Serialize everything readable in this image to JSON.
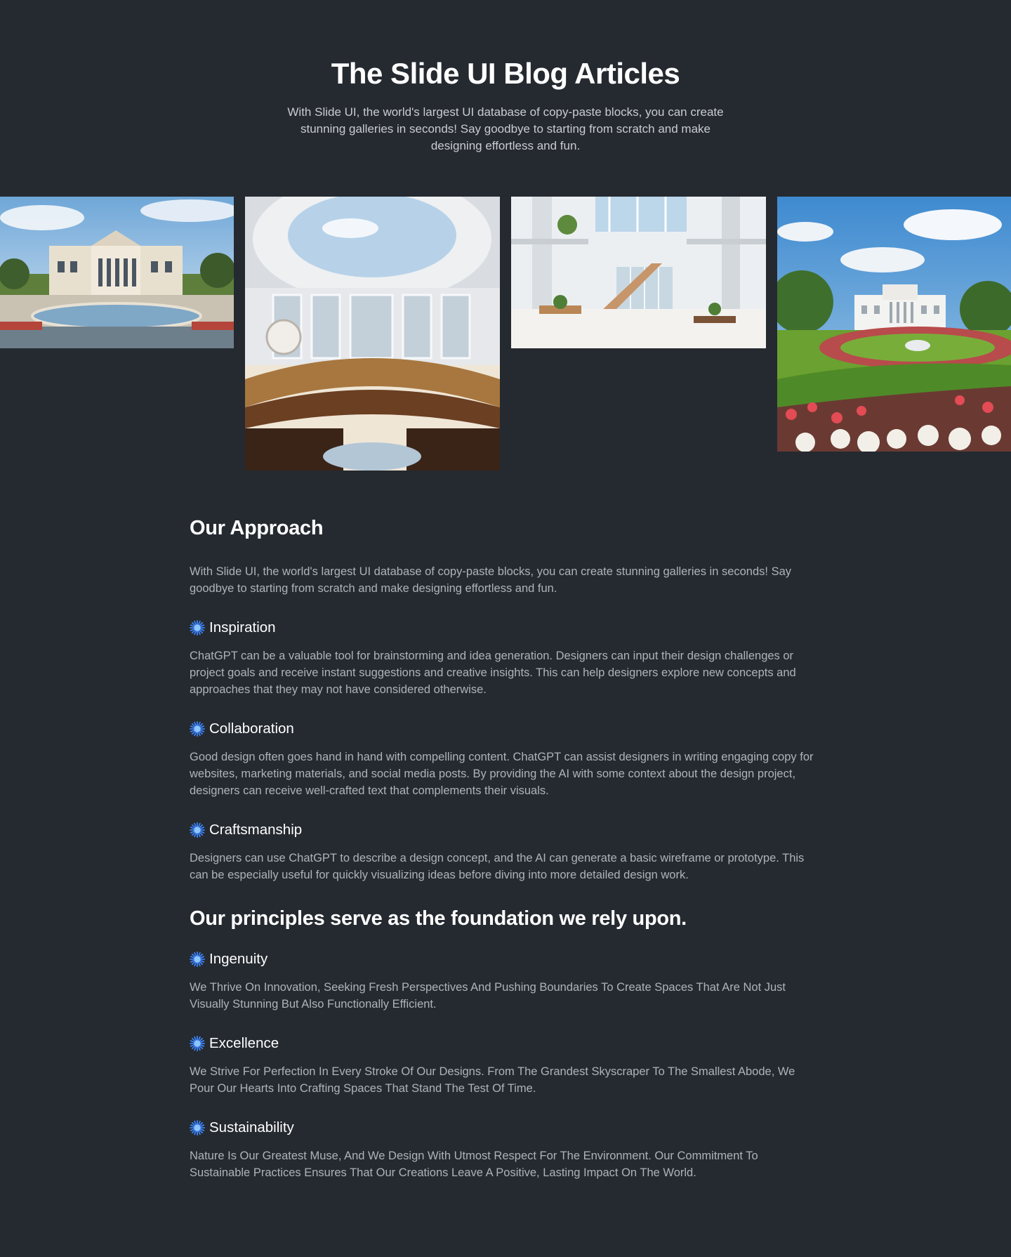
{
  "header": {
    "title": "The Slide UI Blog Articles",
    "subtitle": "With Slide UI, the world's largest UI database of copy-paste blocks, you can create stunning galleries in seconds! Say goodbye to starting from scratch and make designing effortless and fun."
  },
  "gallery": {
    "images": [
      {
        "alt": "Neoclassical mansion with fountain pool"
      },
      {
        "alt": "Domed council chamber interior"
      },
      {
        "alt": "Bright atrium interior with staircase"
      },
      {
        "alt": "White House with flower garden lawn"
      }
    ]
  },
  "approach": {
    "heading": "Our Approach",
    "intro": "With Slide UI, the world's largest UI database of copy-paste blocks, you can create stunning galleries in seconds! Say goodbye to starting from scratch and make designing effortless and fun.",
    "items": [
      {
        "title": "Inspiration",
        "text": "ChatGPT can be a valuable tool for brainstorming and idea generation. Designers can input their design challenges or project goals and receive instant suggestions and creative insights. This can help designers explore new concepts and approaches that they may not have considered otherwise."
      },
      {
        "title": "Collaboration",
        "text": "Good design often goes hand in hand with compelling content. ChatGPT can assist designers in writing engaging copy for websites, marketing materials, and social media posts. By providing the AI with some context about the design project, designers can receive well-crafted text that complements their visuals."
      },
      {
        "title": "Craftsmanship",
        "text": "Designers can use ChatGPT to describe a design concept, and the AI can generate a basic wireframe or prototype. This can be especially useful for quickly visualizing ideas before diving into more detailed design work."
      }
    ]
  },
  "principles": {
    "heading": "Our principles serve as the foundation we rely upon.",
    "items": [
      {
        "title": "Ingenuity",
        "text": "We Thrive On Innovation, Seeking Fresh Perspectives And Pushing Boundaries To Create Spaces That Are Not Just Visually Stunning But Also Functionally Efficient."
      },
      {
        "title": "Excellence",
        "text": "We Strive For Perfection In Every Stroke Of Our Designs. From The Grandest Skyscraper To The Smallest Abode, We Pour Our Hearts Into Crafting Spaces That Stand The Test Of Time."
      },
      {
        "title": "Sustainability",
        "text": "Nature Is Our Greatest Muse, And We Design With Utmost Respect For The Environment. Our Commitment To Sustainable Practices Ensures That Our Creations Leave A Positive, Lasting Impact On The World."
      }
    ]
  },
  "colors": {
    "background": "#252a30",
    "body_text": "#aeb3ba",
    "accent_star": "#3b82f6"
  },
  "icons": {
    "bullet": "starburst-icon"
  }
}
